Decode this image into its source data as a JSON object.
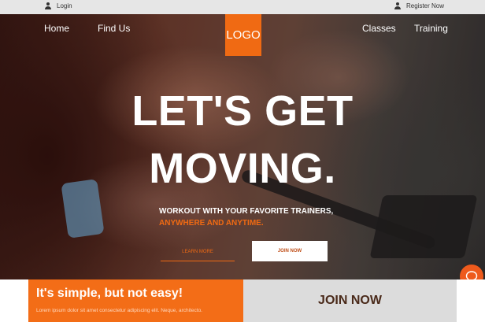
{
  "topbar": {
    "login_label": "Login",
    "register_label": "Register Now"
  },
  "nav": {
    "home": "Home",
    "find_us": "Find Us",
    "classes": "Classes",
    "training": "Training"
  },
  "logo": {
    "text": "LOGO"
  },
  "hero": {
    "headline_line1": "LET'S GET",
    "headline_line2": "MOVING.",
    "subline1": "WORKOUT WITH YOUR FAVORITE TRAINERS,",
    "subline2": "ANYWHERE AND ANYTIME.",
    "learn_more_label": "LEARN MORE",
    "join_now_label": "JOIN NOW"
  },
  "chat": {
    "icon": "chat-bubble-icon"
  },
  "promo": {
    "title": "It's simple, but not easy!",
    "text": "Lorem ipsum dolor sit amet consectetur adipiscing elit. Neque, architecto."
  },
  "join_panel": {
    "label": "JOIN NOW"
  },
  "colors": {
    "accent": "#f06a13",
    "topbar_bg": "#e6e6e6",
    "join_panel_bg": "#dcdcdc",
    "join_panel_text": "#4a2a1a"
  }
}
